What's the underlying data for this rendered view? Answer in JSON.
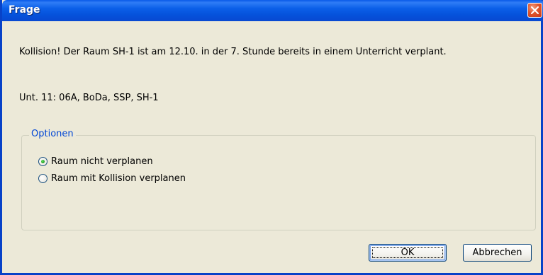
{
  "window": {
    "title": "Frage"
  },
  "message": {
    "line1": "Kollision! Der Raum SH-1 ist am 12.10. in der 7. Stunde bereits in einem Unterricht verplant.",
    "line2": "Unt. 11: 06A, BoDa, SSP, SH-1"
  },
  "options": {
    "legend": "Optionen",
    "items": [
      {
        "label": "Raum nicht verplanen",
        "checked": true
      },
      {
        "label": "Raum mit Kollision verplanen",
        "checked": false
      }
    ]
  },
  "buttons": {
    "ok_label": "OK",
    "cancel_label": "Abbrechen"
  },
  "icons": {
    "close": "close-icon"
  },
  "colors": {
    "titlebar": "#0b5fe8",
    "close": "#e0562d",
    "legend": "#0046d5",
    "background": "#ece9d8"
  }
}
